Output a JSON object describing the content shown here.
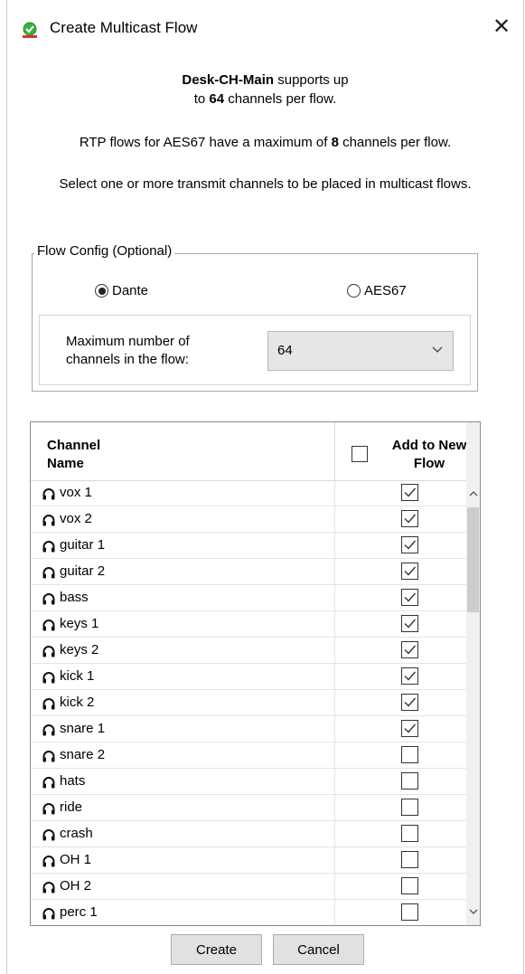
{
  "window": {
    "title": "Create Multicast Flow",
    "close_label": "✕"
  },
  "info": {
    "device": "Desk-CH-Main",
    "line1_suffix": " supports up",
    "line2_prefix": "to ",
    "line2_bold": "64",
    "line2_suffix": " channels per flow.",
    "line3_prefix": "RTP flows for AES67 have a maximum of ",
    "line3_bold": "8",
    "line3_suffix": " channels per flow.",
    "line4": "Select one or more transmit channels to be placed in multicast flows."
  },
  "flow_config": {
    "legend": "Flow Config (Optional)",
    "options": [
      {
        "label": "Dante",
        "selected": true
      },
      {
        "label": "AES67",
        "selected": false
      }
    ],
    "max_label": "Maximum number of channels in the flow:",
    "max_value": "64"
  },
  "table": {
    "col_name": "Channel Name",
    "col_add": "Add to New Flow",
    "header_checked": false,
    "rows": [
      {
        "name": "vox 1",
        "checked": true
      },
      {
        "name": "vox 2",
        "checked": true
      },
      {
        "name": "guitar 1",
        "checked": true
      },
      {
        "name": "guitar 2",
        "checked": true
      },
      {
        "name": "bass",
        "checked": true
      },
      {
        "name": "keys 1",
        "checked": true
      },
      {
        "name": "keys 2",
        "checked": true
      },
      {
        "name": "kick 1",
        "checked": true
      },
      {
        "name": "kick 2",
        "checked": true
      },
      {
        "name": "snare 1",
        "checked": true
      },
      {
        "name": "snare 2",
        "checked": false
      },
      {
        "name": "hats",
        "checked": false
      },
      {
        "name": "ride",
        "checked": false
      },
      {
        "name": "crash",
        "checked": false
      },
      {
        "name": "OH 1",
        "checked": false
      },
      {
        "name": "OH 2",
        "checked": false
      },
      {
        "name": "perc 1",
        "checked": false
      }
    ]
  },
  "buttons": {
    "create": "Create",
    "cancel": "Cancel"
  },
  "colors": {
    "check": "#333333",
    "icon_green": "#3cb043",
    "icon_red": "#d9312b"
  }
}
